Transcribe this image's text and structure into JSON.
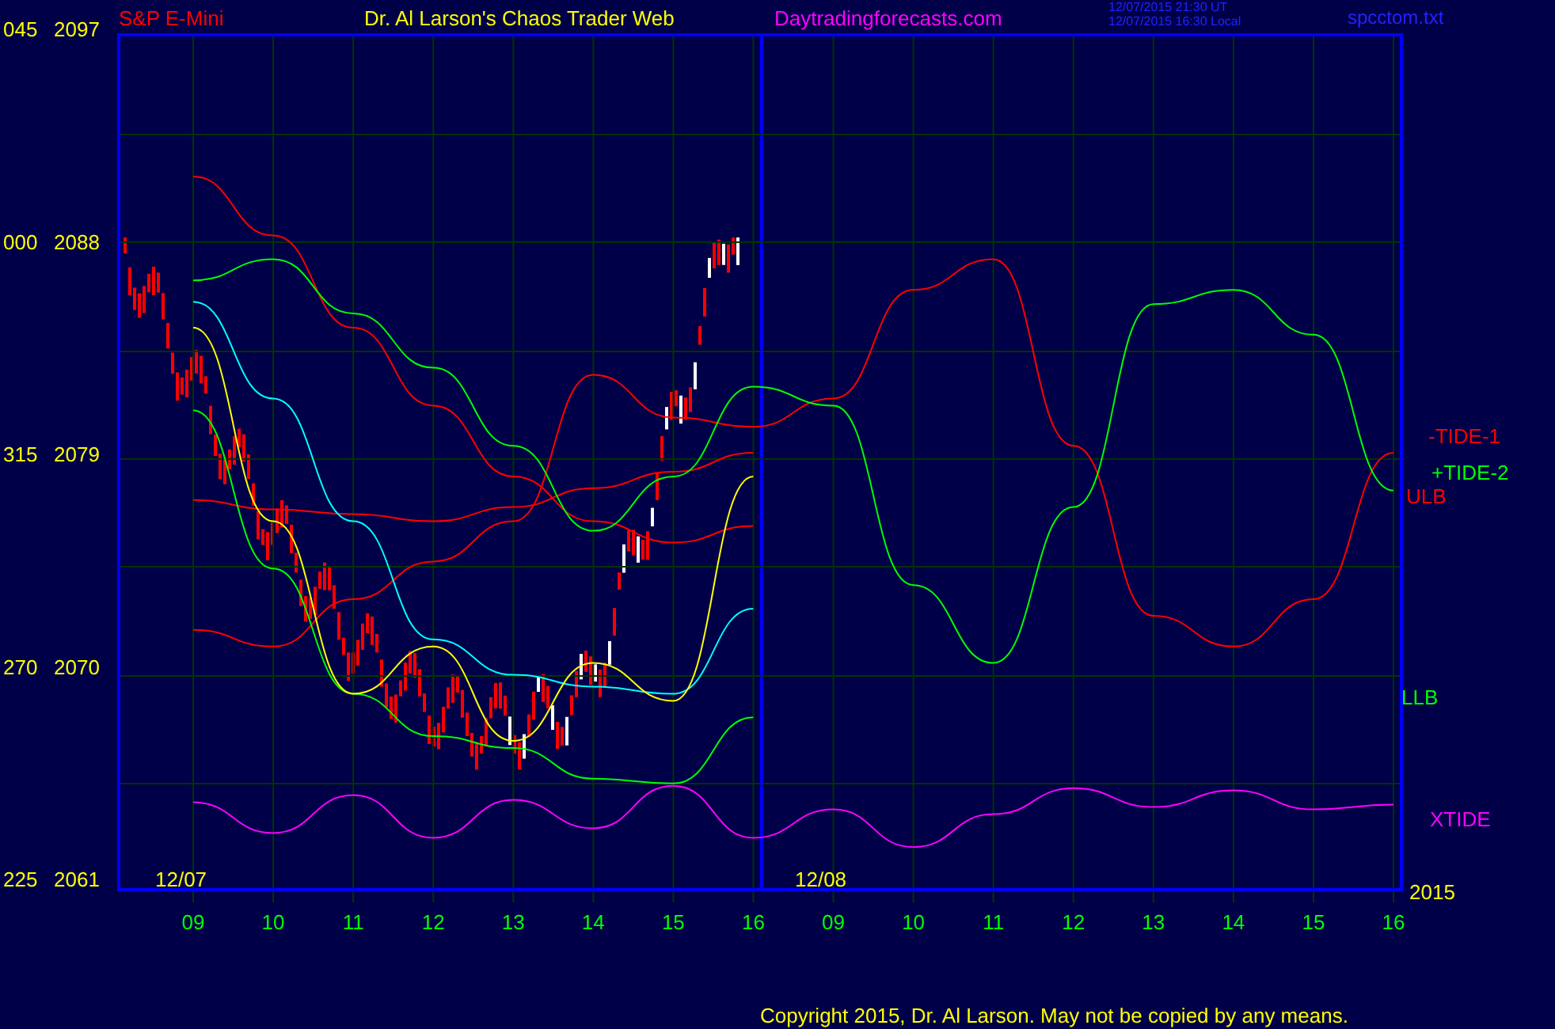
{
  "header": {
    "symbol": "S&P E-Mini",
    "title": "Dr. Al Larson's Chaos Trader Web",
    "website": "Daytradingforecasts.com",
    "timestamp_ut": "12/07/2015 21:30 UT",
    "timestamp_local": "12/07/2015 16:30 Local",
    "filename": "spcctom.txt"
  },
  "angle_labels": [
    "045",
    "000",
    "315",
    "270",
    "225"
  ],
  "date_labels": [
    "12/07",
    "12/08"
  ],
  "year": "2015",
  "chart_data": {
    "type": "line",
    "grid": true,
    "categories": [
      "09",
      "10",
      "11",
      "12",
      "13",
      "14",
      "15",
      "16",
      "09",
      "10",
      "11",
      "12",
      "13",
      "14",
      "15",
      "16"
    ],
    "ylim": [
      2060.8,
      2097.0
    ],
    "yticks": [
      2097,
      2088,
      2079,
      2070,
      2061
    ],
    "series": [
      {
        "name": "ULB",
        "color": "#ff0000",
        "values": [
          2091.0,
          2088.5,
          2084.6,
          2081.3,
          2078.3,
          2076.4,
          2075.5,
          2076.2,
          null,
          null,
          null,
          null,
          null,
          null,
          null,
          null
        ]
      },
      {
        "name": "-TIDE-1",
        "color": "#ff0000",
        "values": [
          2071.8,
          2071.1,
          2073.1,
          2074.7,
          2076.4,
          2082.6,
          2080.8,
          2080.4,
          2081.6,
          2086.2,
          2087.5,
          2079.6,
          2072.4,
          2071.1,
          2073.1,
          2079.3
        ]
      },
      {
        "color": "#ff0000",
        "values": [
          2077.3,
          2076.9,
          2076.7,
          2076.4,
          2077.0,
          2077.8,
          2078.5,
          2079.3,
          null,
          null,
          null,
          null,
          null,
          null,
          null,
          null
        ]
      },
      {
        "name": "+TIDE-2",
        "color": "#00ff00",
        "values": [
          2086.6,
          2087.5,
          2085.2,
          2082.9,
          2079.6,
          2076.0,
          2078.3,
          2082.1,
          2081.3,
          2073.7,
          2070.4,
          2077.0,
          2085.6,
          2086.2,
          2084.3,
          2077.7
        ]
      },
      {
        "name": "LLB",
        "color": "#00ff00",
        "values": [
          2081.1,
          2074.4,
          2069.1,
          2067.3,
          2066.8,
          2065.5,
          2065.3,
          2068.1,
          null,
          null,
          null,
          null,
          null,
          null,
          null,
          null
        ]
      },
      {
        "color": "#00ffff",
        "values": [
          2085.7,
          2081.6,
          2076.4,
          2071.4,
          2069.9,
          2069.4,
          2069.1,
          2072.7,
          null,
          null,
          null,
          null,
          null,
          null,
          null,
          null
        ]
      },
      {
        "color": "#ffff00",
        "values": [
          2084.6,
          2076.4,
          2069.1,
          2071.1,
          2067.1,
          2070.4,
          2068.8,
          2078.3,
          null,
          null,
          null,
          null,
          null,
          null,
          null,
          null
        ]
      },
      {
        "name": "XTIDE",
        "color": "#ff00ff",
        "values": [
          2064.5,
          2063.2,
          2064.8,
          2063.0,
          2064.6,
          2063.4,
          2065.2,
          2063.0,
          2064.2,
          2062.6,
          2064.0,
          2065.1,
          2064.3,
          2065.0,
          2064.2,
          2064.4
        ]
      }
    ]
  },
  "copyright": "Copyright 2015, Dr. Al Larson. May not be copied by any means."
}
